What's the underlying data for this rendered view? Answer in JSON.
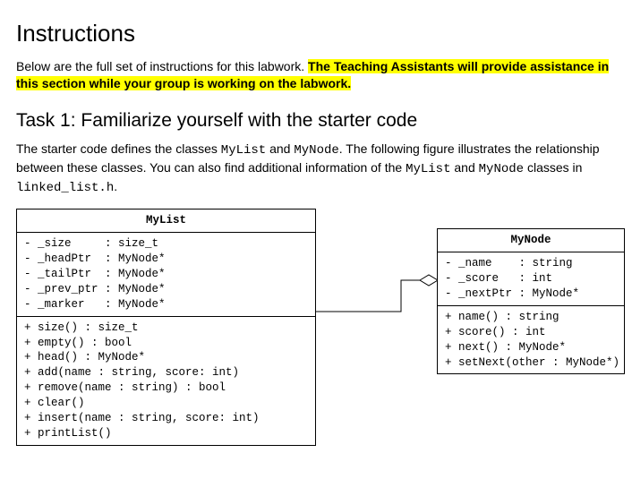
{
  "heading": "Instructions",
  "intro_prefix": "Below are the full set of instructions for this labwork. ",
  "intro_highlight": "The Teaching Assistants will provide assistance in this section while your group is working on the labwork.",
  "task1_title": "Task 1: Familiarize yourself with the starter code",
  "task1_p1_a": "The starter code defines the classes ",
  "task1_p1_code1": "MyList",
  "task1_p1_b": " and ",
  "task1_p1_code2": "MyNode",
  "task1_p1_c": ". The following figure illustrates the relationship between these classes. You can also find additional information of the ",
  "task1_p1_code3": "MyList",
  "task1_p1_d": " and ",
  "task1_p1_code4": "MyNode",
  "task1_p1_e": " classes in ",
  "task1_p1_code5": "linked_list.h",
  "task1_p1_f": ".",
  "uml": {
    "mylist": {
      "name": "MyList",
      "attrs": [
        "- _size     : size_t",
        "- _headPtr  : MyNode*",
        "- _tailPtr  : MyNode*",
        "- _prev_ptr : MyNode*",
        "- _marker   : MyNode*"
      ],
      "ops": [
        "+ size() : size_t",
        "+ empty() : bool",
        "+ head() : MyNode*",
        "+ add(name : string, score: int)",
        "+ remove(name : string) : bool",
        "+ clear()",
        "+ insert(name : string, score: int)",
        "+ printList()"
      ]
    },
    "mynode": {
      "name": "MyNode",
      "attrs": [
        "- _name    : string",
        "- _score   : int",
        "- _nextPtr : MyNode*"
      ],
      "ops": [
        "+ name() : string",
        "+ score() : int",
        "+ next() : MyNode*",
        "+ setNext(other : MyNode*)"
      ]
    }
  }
}
